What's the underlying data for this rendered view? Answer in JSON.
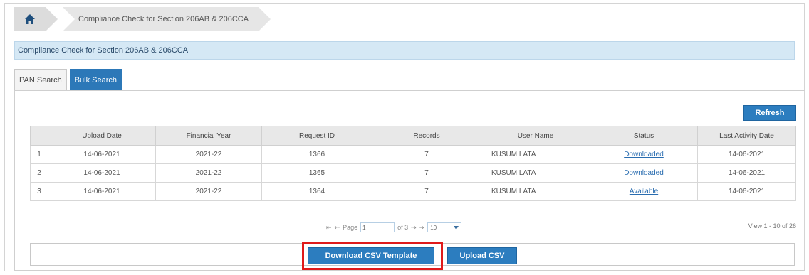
{
  "breadcrumb": {
    "home_icon": "home-icon",
    "current": "Compliance Check for Section 206AB & 206CCA"
  },
  "section": {
    "title": "Compliance Check for Section 206AB & 206CCA"
  },
  "tabs": [
    {
      "label": "PAN Search",
      "active": false
    },
    {
      "label": "Bulk Search",
      "active": true
    }
  ],
  "refresh_label": "Refresh",
  "table": {
    "headers": [
      "",
      "Upload Date",
      "Financial Year",
      "Request ID",
      "Records",
      "User Name",
      "Status",
      "Last Activity Date"
    ],
    "rows": [
      {
        "n": "1",
        "upload_date": "14-06-2021",
        "fy": "2021-22",
        "request_id": "1366",
        "records": "7",
        "user": "KUSUM LATA",
        "status": "Downloaded",
        "last_activity": "14-06-2021"
      },
      {
        "n": "2",
        "upload_date": "14-06-2021",
        "fy": "2021-22",
        "request_id": "1365",
        "records": "7",
        "user": "KUSUM LATA",
        "status": "Downloaded",
        "last_activity": "14-06-2021"
      },
      {
        "n": "3",
        "upload_date": "14-06-2021",
        "fy": "2021-22",
        "request_id": "1364",
        "records": "7",
        "user": "KUSUM LATA",
        "status": "Available",
        "last_activity": "14-06-2021"
      }
    ]
  },
  "pager": {
    "first": "⇤",
    "prev": "⇠",
    "page_label": "Page",
    "page_value": "1",
    "of_label": "of 3",
    "next": "⇢",
    "last": "⇥",
    "page_size": "10",
    "view_info": "View 1 - 10 of 26"
  },
  "actions": {
    "download_label": "Download CSV Template",
    "upload_label": "Upload CSV"
  },
  "colors": {
    "accent": "#2c7dbf",
    "header_band": "#d5e8f5",
    "highlight": "#e01a1a"
  }
}
